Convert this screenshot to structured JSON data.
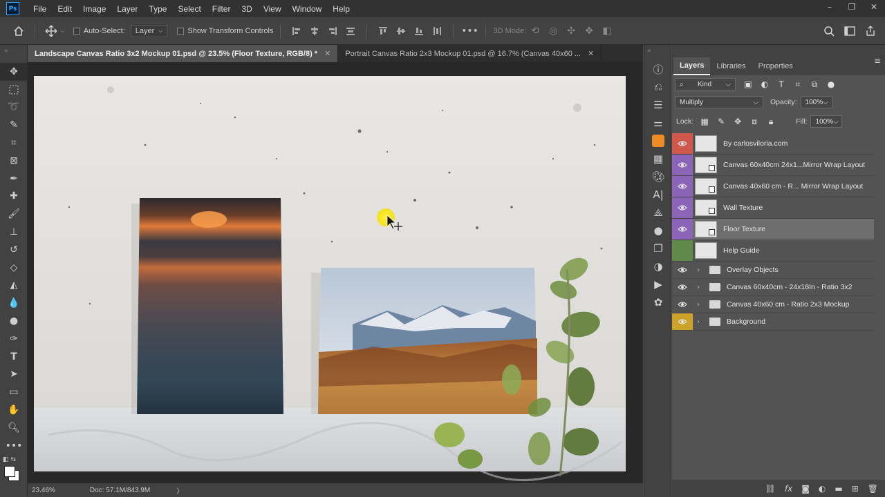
{
  "app": {
    "logo_text": "Ps",
    "menu": [
      "File",
      "Edit",
      "Image",
      "Layer",
      "Type",
      "Select",
      "Filter",
      "3D",
      "View",
      "Window",
      "Help"
    ],
    "window_controls": [
      "–",
      "❐",
      "✕"
    ]
  },
  "options": {
    "auto_select_label": "Auto-Select:",
    "auto_select_value": "Layer",
    "show_transform_label": "Show Transform Controls",
    "mode_3d_label": "3D Mode:",
    "more_label": "•••"
  },
  "tabs": [
    {
      "label": "Landscape Canvas Ratio 3x2 Mockup 01.psd @ 23.5% (Floor Texture, RGB/8) *",
      "close": "✕",
      "active": true
    },
    {
      "label": "Portrait Canvas Ratio 2x3 Mockup 01.psd @ 16.7% (Canvas 40x60 ...",
      "close": "✕",
      "active": false
    }
  ],
  "status": {
    "zoom": "23.46%",
    "doc": "Doc: 57.1M/843.9M",
    "arrow": "〉"
  },
  "panel": {
    "tabs": [
      "Layers",
      "Libraries",
      "Properties"
    ],
    "filter_kind": "Kind",
    "blend_mode": "Multiply",
    "opacity_label": "Opacity:",
    "opacity_value": "100%",
    "lock_label": "Lock:",
    "fill_label": "Fill:",
    "fill_value": "100%"
  },
  "layers": [
    {
      "name": "By carlosviloria.com",
      "color": "#d0574b",
      "visible": true,
      "type": "layer",
      "smart": false
    },
    {
      "name": "Canvas 60x40cm 24x1...Mirror Wrap Layout",
      "color": "#8b64b8",
      "visible": true,
      "type": "layer",
      "smart": true
    },
    {
      "name": "Canvas 40x60 cm - R... Mirror Wrap Layout",
      "color": "#8b64b8",
      "visible": true,
      "type": "layer",
      "smart": true
    },
    {
      "name": "Wall Texture",
      "color": "#8b64b8",
      "visible": true,
      "type": "layer",
      "smart": true
    },
    {
      "name": "Floor Texture",
      "color": "#8b64b8",
      "visible": true,
      "type": "layer",
      "smart": true,
      "selected": true
    },
    {
      "name": "Help Guide",
      "color": "#5f8a4a",
      "visible": false,
      "type": "layer",
      "smart": false
    },
    {
      "name": "Overlay Objects",
      "color": "",
      "visible": true,
      "type": "group"
    },
    {
      "name": "Canvas 60x40cm - 24x18In - Ratio 3x2",
      "color": "",
      "visible": true,
      "type": "group"
    },
    {
      "name": "Canvas 40x60 cm - Ratio 2x3 Mockup",
      "color": "",
      "visible": true,
      "type": "group"
    },
    {
      "name": "Background",
      "color": "#c9a227",
      "visible": true,
      "type": "group"
    }
  ],
  "icons": {
    "eye": "visibility-eye-icon",
    "folder": "folder-icon"
  }
}
